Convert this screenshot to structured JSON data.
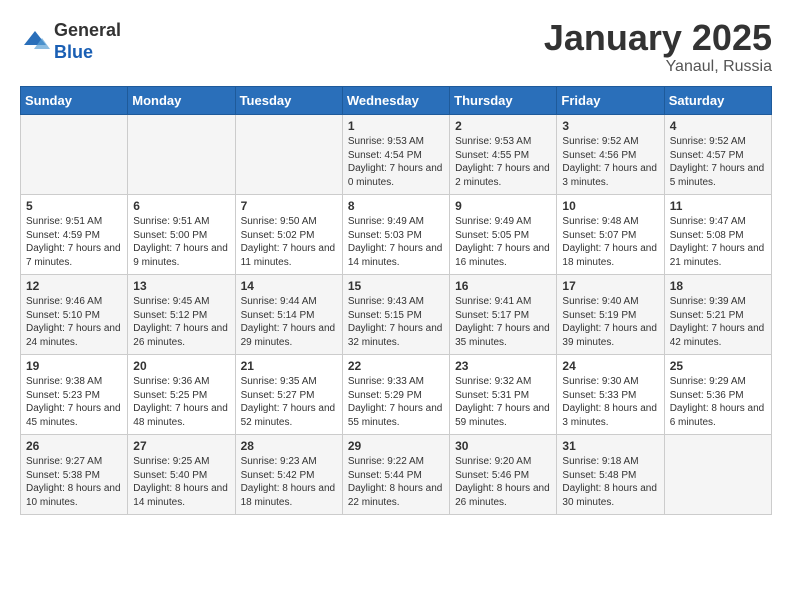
{
  "header": {
    "logo_general": "General",
    "logo_blue": "Blue",
    "month_title": "January 2025",
    "subtitle": "Yanaul, Russia"
  },
  "days_of_week": [
    "Sunday",
    "Monday",
    "Tuesday",
    "Wednesday",
    "Thursday",
    "Friday",
    "Saturday"
  ],
  "weeks": [
    [
      {
        "day": "",
        "content": ""
      },
      {
        "day": "",
        "content": ""
      },
      {
        "day": "",
        "content": ""
      },
      {
        "day": "1",
        "content": "Sunrise: 9:53 AM\nSunset: 4:54 PM\nDaylight: 7 hours and 0 minutes."
      },
      {
        "day": "2",
        "content": "Sunrise: 9:53 AM\nSunset: 4:55 PM\nDaylight: 7 hours and 2 minutes."
      },
      {
        "day": "3",
        "content": "Sunrise: 9:52 AM\nSunset: 4:56 PM\nDaylight: 7 hours and 3 minutes."
      },
      {
        "day": "4",
        "content": "Sunrise: 9:52 AM\nSunset: 4:57 PM\nDaylight: 7 hours and 5 minutes."
      }
    ],
    [
      {
        "day": "5",
        "content": "Sunrise: 9:51 AM\nSunset: 4:59 PM\nDaylight: 7 hours and 7 minutes."
      },
      {
        "day": "6",
        "content": "Sunrise: 9:51 AM\nSunset: 5:00 PM\nDaylight: 7 hours and 9 minutes."
      },
      {
        "day": "7",
        "content": "Sunrise: 9:50 AM\nSunset: 5:02 PM\nDaylight: 7 hours and 11 minutes."
      },
      {
        "day": "8",
        "content": "Sunrise: 9:49 AM\nSunset: 5:03 PM\nDaylight: 7 hours and 14 minutes."
      },
      {
        "day": "9",
        "content": "Sunrise: 9:49 AM\nSunset: 5:05 PM\nDaylight: 7 hours and 16 minutes."
      },
      {
        "day": "10",
        "content": "Sunrise: 9:48 AM\nSunset: 5:07 PM\nDaylight: 7 hours and 18 minutes."
      },
      {
        "day": "11",
        "content": "Sunrise: 9:47 AM\nSunset: 5:08 PM\nDaylight: 7 hours and 21 minutes."
      }
    ],
    [
      {
        "day": "12",
        "content": "Sunrise: 9:46 AM\nSunset: 5:10 PM\nDaylight: 7 hours and 24 minutes."
      },
      {
        "day": "13",
        "content": "Sunrise: 9:45 AM\nSunset: 5:12 PM\nDaylight: 7 hours and 26 minutes."
      },
      {
        "day": "14",
        "content": "Sunrise: 9:44 AM\nSunset: 5:14 PM\nDaylight: 7 hours and 29 minutes."
      },
      {
        "day": "15",
        "content": "Sunrise: 9:43 AM\nSunset: 5:15 PM\nDaylight: 7 hours and 32 minutes."
      },
      {
        "day": "16",
        "content": "Sunrise: 9:41 AM\nSunset: 5:17 PM\nDaylight: 7 hours and 35 minutes."
      },
      {
        "day": "17",
        "content": "Sunrise: 9:40 AM\nSunset: 5:19 PM\nDaylight: 7 hours and 39 minutes."
      },
      {
        "day": "18",
        "content": "Sunrise: 9:39 AM\nSunset: 5:21 PM\nDaylight: 7 hours and 42 minutes."
      }
    ],
    [
      {
        "day": "19",
        "content": "Sunrise: 9:38 AM\nSunset: 5:23 PM\nDaylight: 7 hours and 45 minutes."
      },
      {
        "day": "20",
        "content": "Sunrise: 9:36 AM\nSunset: 5:25 PM\nDaylight: 7 hours and 48 minutes."
      },
      {
        "day": "21",
        "content": "Sunrise: 9:35 AM\nSunset: 5:27 PM\nDaylight: 7 hours and 52 minutes."
      },
      {
        "day": "22",
        "content": "Sunrise: 9:33 AM\nSunset: 5:29 PM\nDaylight: 7 hours and 55 minutes."
      },
      {
        "day": "23",
        "content": "Sunrise: 9:32 AM\nSunset: 5:31 PM\nDaylight: 7 hours and 59 minutes."
      },
      {
        "day": "24",
        "content": "Sunrise: 9:30 AM\nSunset: 5:33 PM\nDaylight: 8 hours and 3 minutes."
      },
      {
        "day": "25",
        "content": "Sunrise: 9:29 AM\nSunset: 5:36 PM\nDaylight: 8 hours and 6 minutes."
      }
    ],
    [
      {
        "day": "26",
        "content": "Sunrise: 9:27 AM\nSunset: 5:38 PM\nDaylight: 8 hours and 10 minutes."
      },
      {
        "day": "27",
        "content": "Sunrise: 9:25 AM\nSunset: 5:40 PM\nDaylight: 8 hours and 14 minutes."
      },
      {
        "day": "28",
        "content": "Sunrise: 9:23 AM\nSunset: 5:42 PM\nDaylight: 8 hours and 18 minutes."
      },
      {
        "day": "29",
        "content": "Sunrise: 9:22 AM\nSunset: 5:44 PM\nDaylight: 8 hours and 22 minutes."
      },
      {
        "day": "30",
        "content": "Sunrise: 9:20 AM\nSunset: 5:46 PM\nDaylight: 8 hours and 26 minutes."
      },
      {
        "day": "31",
        "content": "Sunrise: 9:18 AM\nSunset: 5:48 PM\nDaylight: 8 hours and 30 minutes."
      },
      {
        "day": "",
        "content": ""
      }
    ]
  ]
}
